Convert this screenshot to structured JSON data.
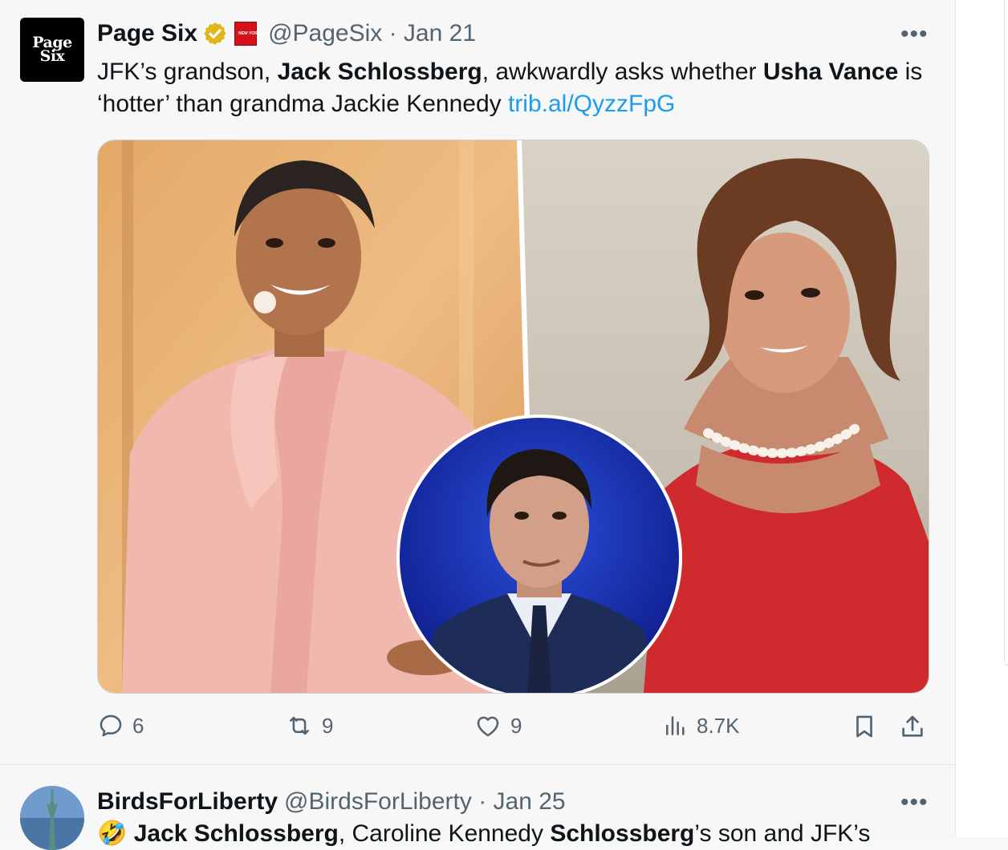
{
  "tweet1": {
    "avatar_text": "Page Six",
    "name": "Page Six",
    "handle_time": "@PageSix · Jan 21",
    "more": "•••",
    "text_parts": {
      "a": "JFK’s grandson, ",
      "b": "Jack Schlossberg",
      "c": ", awkwardly asks whether ",
      "d": "Usha Vance",
      "e": " is ‘hotter’ than grandma Jackie Kennedy ",
      "link": "trib.al/QyzzFpG"
    },
    "badge_text": "NEW YORK POST",
    "actions": {
      "replies": "6",
      "reposts": "9",
      "likes": "9",
      "views": "8.7K"
    }
  },
  "tweet2": {
    "name": "BirdsForLiberty",
    "handle_time": "@BirdsForLiberty · Jan 25",
    "more": "•••",
    "text_parts": {
      "emoji": "🤣",
      "a": " Jack Schlossberg",
      "b": ", Caroline Kennedy ",
      "c": "Schlossberg",
      "d": "’s son and JFK’s"
    }
  },
  "colors": {
    "accent": "#1d9bf0",
    "secondary_text": "#536471",
    "verified_gold": "#e2b719",
    "nypost_red": "#d5121c"
  },
  "icons": [
    "verified-icon",
    "reply-icon",
    "repost-icon",
    "like-icon",
    "views-icon",
    "bookmark-icon",
    "share-icon"
  ]
}
